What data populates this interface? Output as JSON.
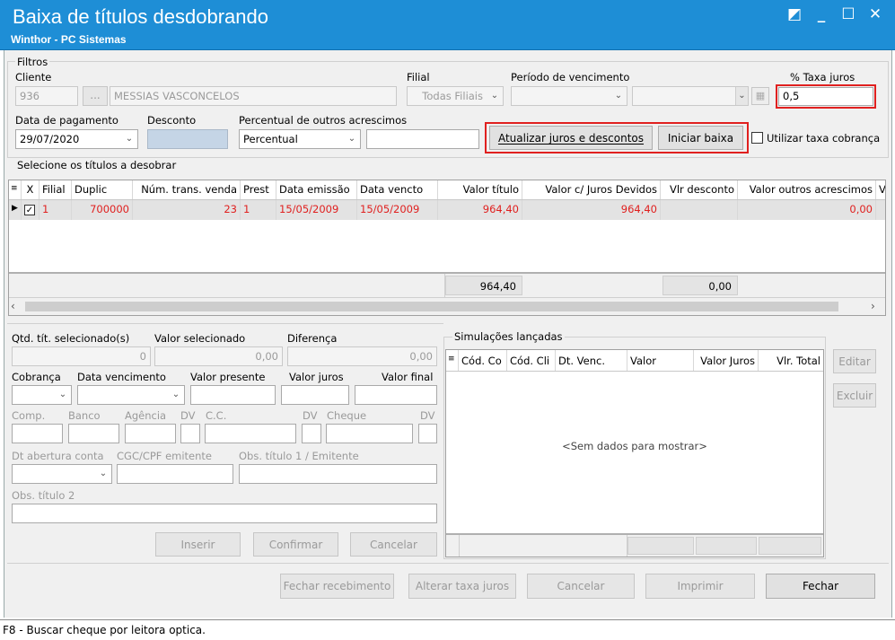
{
  "window": {
    "title": "Baixa de títulos desdobrando",
    "subtitle": "Winthor - PC Sistemas",
    "btn_restore": "◩",
    "btn_min": "_",
    "btn_max": "☐",
    "btn_close": "✕"
  },
  "filtros": {
    "group_label": "Filtros",
    "cliente_label": "Cliente",
    "cliente_code": "936",
    "cliente_ellipsis": "...",
    "cliente_name": "MESSIAS VASCONCELOS",
    "filial_label": "Filial",
    "filial_value": "Todas Filiais",
    "periodo_label": "Período de vencimento",
    "taxa_label": "% Taxa juros",
    "taxa_value": "0,5",
    "data_pagamento_label": "Data de pagamento",
    "data_pagamento_value": "29/07/2020",
    "desconto_label": "Desconto",
    "perc_outros_label": "Percentual de outros acrescimos",
    "perc_outros_value": "Percentual",
    "btn_atualizar": "Atualizar juros e descontos",
    "btn_iniciar": "Iniciar baixa",
    "utilizar_taxa_label": "Utilizar taxa cobrança"
  },
  "titulos": {
    "group_label": "Selecione os títulos a desobrar",
    "headers": {
      "x": "X",
      "filial": "Filial",
      "duplic": "Duplic",
      "num_trans": "Núm. trans. venda",
      "prest": "Prest",
      "data_emissao": "Data emissão",
      "data_vencto": "Data vencto",
      "valor_titulo": "Valor título",
      "valor_juros": "Valor c/ Juros Devidos",
      "vlr_desconto": "Vlr desconto",
      "valor_outros": "Valor outros acrescimos",
      "extra": "V"
    },
    "row": {
      "filial": "1",
      "duplic": "700000",
      "num_trans": "23",
      "prest": "1",
      "data_emissao": "15/05/2009",
      "data_vencto": "15/05/2009",
      "valor_titulo": "964,40",
      "valor_juros": "964,40",
      "valor_outros": "0,00"
    },
    "footer": {
      "total_titulo": "964,40",
      "total_desconto": "0,00"
    }
  },
  "detalhes": {
    "qtd_label": "Qtd. tít. selecionado(s)",
    "qtd_value": "0",
    "valor_sel_label": "Valor selecionado",
    "valor_sel_value": "0,00",
    "diferenca_label": "Diferença",
    "diferenca_value": "0,00",
    "cobranca_label": "Cobrança",
    "data_venc_label": "Data vencimento",
    "valor_presente_label": "Valor presente",
    "valor_juros_label": "Valor juros",
    "valor_final_label": "Valor final",
    "comp_label": "Comp.",
    "banco_label": "Banco",
    "agencia_label": "Agência",
    "dv_label": "DV",
    "cc_label": "C.C.",
    "dv2_label": "DV",
    "cheque_label": "Cheque",
    "dv3_label": "DV",
    "dt_abertura_label": "Dt abertura conta",
    "cgc_label": "CGC/CPF emitente",
    "obs1_label": "Obs. título 1 / Emitente",
    "obs2_label": "Obs. título 2",
    "btn_inserir": "Inserir",
    "btn_confirmar": "Confirmar",
    "btn_cancelar": "Cancelar"
  },
  "simulacoes": {
    "group_label": "Simulações lançadas",
    "headers": {
      "cod_co": "Cód. Co",
      "cod_cli": "Cód. Cli",
      "dt_venc": "Dt. Venc.",
      "valor": "Valor",
      "valor_juros": "Valor Juros",
      "vlr_total": "Vlr. Total"
    },
    "empty": "<Sem dados para mostrar>",
    "btn_editar": "Editar",
    "btn_excluir": "Excluir"
  },
  "bottom": {
    "btn_fechar_receb": "Fechar recebimento",
    "btn_alterar": "Alterar taxa juros",
    "btn_cancelar": "Cancelar",
    "btn_imprimir": "Imprimir",
    "btn_fechar": "Fechar"
  },
  "status": {
    "text": "F8 - Buscar cheque por leitora optica."
  }
}
